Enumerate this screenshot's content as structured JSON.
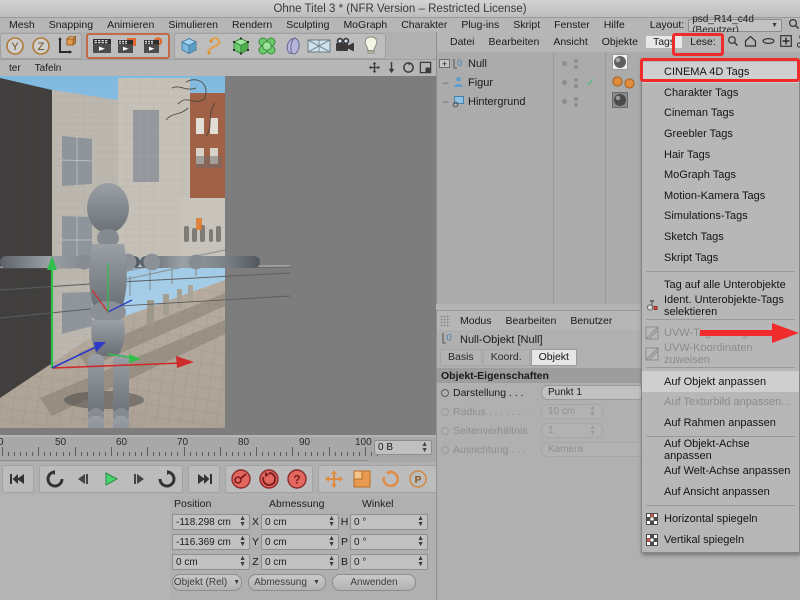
{
  "window": {
    "title": "Ohne Titel 3 * (NFR Version – Restricted License)"
  },
  "menubar": {
    "items": [
      "Mesh",
      "Snapping",
      "Animieren",
      "Simulieren",
      "Rendern",
      "Sculpting",
      "MoGraph",
      "Charakter",
      "Plug-ins",
      "Skript",
      "Fenster",
      "Hilfe"
    ],
    "layout_label": "Layout:",
    "layout_value": "psd_R14_c4d (Benutzer)",
    "search_icon": "search-icon"
  },
  "toolbar": {
    "axis_buttons": [
      "Y",
      "Z"
    ],
    "icons": [
      "world-axis-icon",
      "cube-icon",
      "render-view-icon",
      "render-region-icon",
      "render-settings-icon",
      "cube-primitive-icon",
      "spline-icon",
      "nurbs-icon",
      "mograph-icon",
      "deformer-icon",
      "floor-environment-icon",
      "camera-icon",
      "light-icon"
    ]
  },
  "viewport": {
    "menu_items": [
      "ter",
      "Tafeln"
    ],
    "nav_icons": [
      "move-view-icon",
      "dolly-view-icon",
      "rotate-view-icon",
      "maximize-view-icon"
    ],
    "scene_description": "3D-Ansicht: Figur (Mannequin) vor Straßen-Hintergrundbild"
  },
  "timeline": {
    "tick_labels": [
      "0",
      "50",
      "60",
      "70",
      "80",
      "90",
      "100"
    ],
    "frame_field": "0 B"
  },
  "transport": {
    "buttons": [
      "go-to-start-icon",
      "previous-key-icon",
      "step-back-icon",
      "play-icon",
      "step-forward-icon",
      "loop-icon",
      "go-to-end-icon",
      "record-key-icon",
      "autokey-icon",
      "keyframe-selection-icon",
      "move-tool-icon",
      "scale-tool-icon",
      "rotate-tool-icon",
      "parametric-icon",
      "point-mode-icon",
      "timeline-icon"
    ]
  },
  "coords": {
    "headers": [
      "Position",
      "Abmessung",
      "Winkel"
    ],
    "rows": [
      {
        "axis_pos": "X",
        "pos": "-118.298 cm",
        "axis_size": "X",
        "size": "0 cm",
        "axis_rot": "H",
        "rot": "0 °"
      },
      {
        "axis_pos": "Y",
        "pos": "-116.369 cm",
        "axis_size": "Y",
        "size": "0 cm",
        "axis_rot": "P",
        "rot": "0 °"
      },
      {
        "axis_pos": "Z",
        "pos": "0 cm",
        "axis_size": "Z",
        "size": "0 cm",
        "axis_rot": "B",
        "rot": "0 °"
      }
    ],
    "mode_select": "Objekt (Rel)",
    "size_select": "Abmessung",
    "apply_button": "Anwenden"
  },
  "object_manager": {
    "menu_items": [
      "Datei",
      "Bearbeiten",
      "Ansicht",
      "Objekte",
      "Tags",
      "Lese:"
    ],
    "active_menu": "Tags",
    "right_icons": [
      "search-icon",
      "home-icon",
      "ellipse-icon",
      "add-icon",
      "layer-icon"
    ],
    "tree": [
      {
        "label": "Null",
        "icon": "null-object-icon",
        "expander": "+",
        "tag": "texture-tag-icon",
        "checked": false
      },
      {
        "label": "Figur",
        "icon": "figure-icon",
        "expander": "",
        "tag": "dual-material-tag-icon",
        "checked": true
      },
      {
        "label": "Hintergrund",
        "icon": "background-icon",
        "expander": "",
        "tag": "background-texture-tag-icon",
        "checked": false
      }
    ]
  },
  "attribute_manager": {
    "menu_items": [
      "Modus",
      "Bearbeiten",
      "Benutzer"
    ],
    "object_title": "Null-Objekt [Null]",
    "object_icon": "null-object-icon",
    "tabs": [
      "Basis",
      "Koord.",
      "Objekt"
    ],
    "active_tab": "Objekt",
    "section_title": "Objekt-Eigenschaften",
    "properties": [
      {
        "label": "Darstellung . . .",
        "value": "Punkt 1",
        "disabled": false
      },
      {
        "label": "Radius . . . . . . . .",
        "value": "10 cm",
        "disabled": true,
        "spinner": true
      },
      {
        "label": "Seitenverhältnis",
        "value": "1",
        "disabled": true,
        "spinner": true
      },
      {
        "label": "Ausrichtung . . .",
        "value": "Kamera",
        "disabled": true
      }
    ]
  },
  "dropdown": {
    "groups": [
      [
        {
          "label": "CINEMA 4D Tags",
          "highlighted": true,
          "disabled": false,
          "icon": ""
        },
        {
          "label": "Charakter Tags",
          "highlighted": false,
          "disabled": false,
          "icon": ""
        },
        {
          "label": "Cineman Tags",
          "highlighted": false,
          "disabled": false,
          "icon": ""
        },
        {
          "label": "Greebler Tags",
          "highlighted": false,
          "disabled": false,
          "icon": ""
        },
        {
          "label": "Hair Tags",
          "highlighted": false,
          "disabled": false,
          "icon": ""
        },
        {
          "label": "MoGraph Tags",
          "highlighted": false,
          "disabled": false,
          "icon": ""
        },
        {
          "label": "Motion-Kamera Tags",
          "highlighted": false,
          "disabled": false,
          "icon": ""
        },
        {
          "label": "Simulations-Tags",
          "highlighted": false,
          "disabled": false,
          "icon": ""
        },
        {
          "label": "Sketch Tags",
          "highlighted": false,
          "disabled": false,
          "icon": ""
        },
        {
          "label": "Skript Tags",
          "highlighted": false,
          "disabled": false,
          "icon": ""
        }
      ],
      [
        {
          "label": "Tag auf alle Unterobjekte",
          "highlighted": false,
          "disabled": false,
          "icon": ""
        },
        {
          "label": "Ident. Unterobjekte-Tags selektieren",
          "highlighted": false,
          "disabled": false,
          "icon": "select-identical-icon"
        }
      ],
      [
        {
          "label": "UVW-Tag erzeugen",
          "highlighted": false,
          "disabled": true,
          "icon": "uvw-icon"
        },
        {
          "label": "UVW-Koordinaten zuweisen",
          "highlighted": false,
          "disabled": true,
          "icon": "uvw-icon"
        }
      ],
      [
        {
          "label": "Auf Objekt anpassen",
          "highlighted": true,
          "disabled": false,
          "icon": ""
        },
        {
          "label": "Auf Texturbild anpassen...",
          "highlighted": false,
          "disabled": true,
          "icon": ""
        },
        {
          "label": "Auf Rahmen anpassen",
          "highlighted": false,
          "disabled": false,
          "icon": ""
        }
      ],
      [
        {
          "label": "Auf Objekt-Achse anpassen",
          "highlighted": false,
          "disabled": false,
          "icon": ""
        },
        {
          "label": "Auf Welt-Achse anpassen",
          "highlighted": false,
          "disabled": false,
          "icon": ""
        },
        {
          "label": "Auf Ansicht anpassen",
          "highlighted": false,
          "disabled": false,
          "icon": ""
        }
      ],
      [
        {
          "label": "Horizontal spiegeln",
          "highlighted": false,
          "disabled": false,
          "icon": "mirror-h-icon"
        },
        {
          "label": "Vertikal spiegeln",
          "highlighted": false,
          "disabled": false,
          "icon": "mirror-v-icon"
        }
      ]
    ]
  },
  "annotations": {
    "highlight_color": "#ef2b2b",
    "boxes": [
      "tags-menu-highlight",
      "cinema-4d-tags-highlight"
    ],
    "arrow": "red-arrow-pointing-to-auf-objekt-anpassen"
  }
}
